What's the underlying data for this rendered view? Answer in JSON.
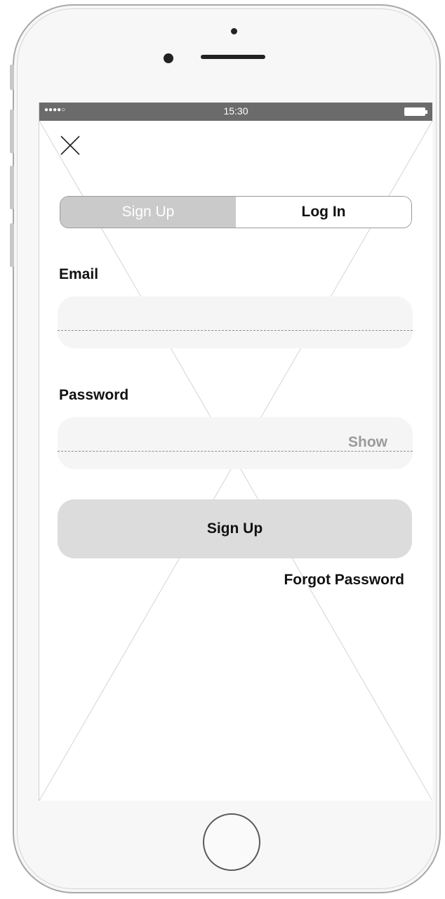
{
  "status_bar": {
    "signal": "●●●●○",
    "time": "15:30"
  },
  "tabs": [
    {
      "label": "Sign Up",
      "active": true
    },
    {
      "label": "Log In",
      "active": false
    }
  ],
  "form": {
    "email_label": "Email",
    "email_value": "",
    "password_label": "Password",
    "password_value": "",
    "show_label": "Show"
  },
  "actions": {
    "submit_label": "Sign Up",
    "forgot_label": "Forgot Password"
  },
  "icons": {
    "close": "close-icon"
  },
  "colors": {
    "status_bar": "#6b6b6b",
    "active_tab": "#cacaca",
    "button": "#dcdcdc",
    "field": "#f5f5f5"
  }
}
